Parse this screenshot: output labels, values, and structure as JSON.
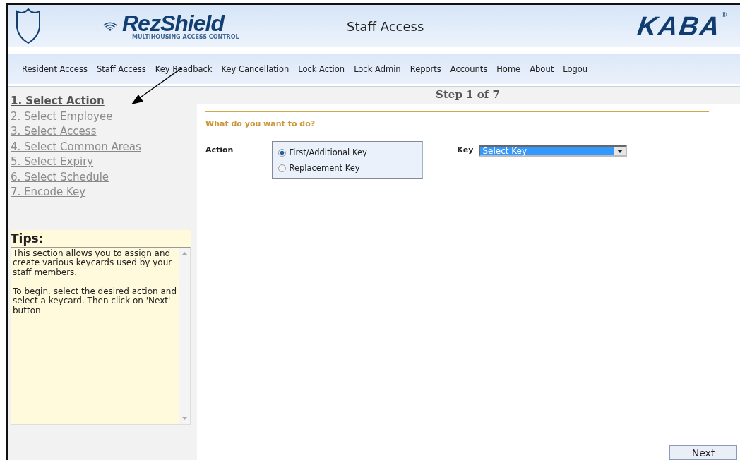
{
  "header": {
    "logo": "RezShield",
    "logo_tagline": "MULTIHOUSING ACCESS CONTROL",
    "title": "Staff Access",
    "brand": "KABA",
    "brand_mark": "®"
  },
  "nav": [
    "Resident Access",
    "Staff Access",
    "Key Readback",
    "Key Cancellation",
    "Lock Action",
    "Lock Admin",
    "Reports",
    "Accounts",
    "Home",
    "About",
    "Logou"
  ],
  "steps": [
    {
      "label": "1. Select Action",
      "selected": true
    },
    {
      "label": "2. Select Employee",
      "selected": false
    },
    {
      "label": "3. Select Access",
      "selected": false
    },
    {
      "label": "4. Select Common Areas",
      "selected": false
    },
    {
      "label": "5. Select Expiry",
      "selected": false
    },
    {
      "label": "6. Select Schedule",
      "selected": false
    },
    {
      "label": "7. Encode Key",
      "selected": false
    }
  ],
  "tips": {
    "title": "Tips:",
    "text": "This section allows you to assign and create various keycards used by your staff members.\n\nTo begin, select the desired action and select a keycard. Then click on 'Next' button"
  },
  "step_indicator": "Step 1 of 7",
  "question": "What do you want to do?",
  "action": {
    "label": "Action",
    "options": [
      {
        "label": "First/Additional Key",
        "selected": true
      },
      {
        "label": "Replacement Key",
        "selected": false
      }
    ]
  },
  "key": {
    "label": "Key",
    "value": "Select Key"
  },
  "buttons": [
    "Next"
  ]
}
